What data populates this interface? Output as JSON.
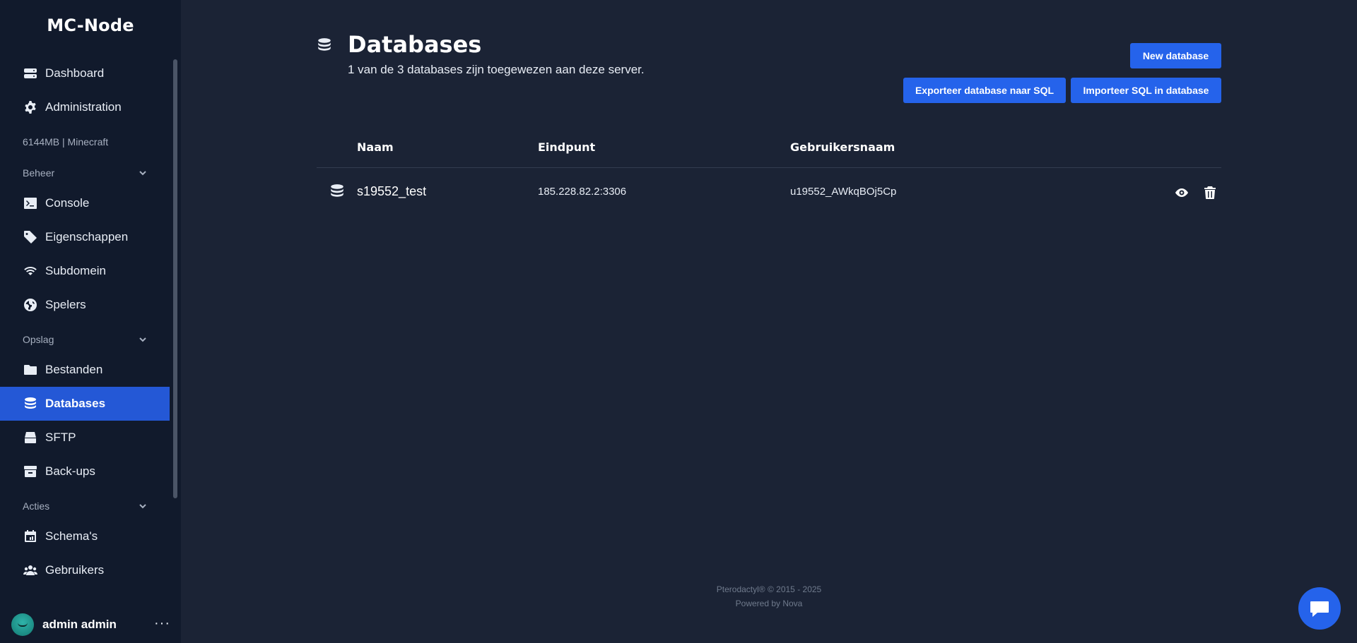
{
  "brand": "MC-Node",
  "sidebar": {
    "top_items": [
      {
        "label": "Dashboard",
        "icon": "server-icon"
      },
      {
        "label": "Administration",
        "icon": "gear-icon"
      }
    ],
    "server_info": "6144MB | Minecraft",
    "sections": [
      {
        "title": "Beheer",
        "items": [
          {
            "label": "Console",
            "icon": "terminal-icon"
          },
          {
            "label": "Eigenschappen",
            "icon": "tag-icon"
          },
          {
            "label": "Subdomein",
            "icon": "wifi-icon"
          },
          {
            "label": "Spelers",
            "icon": "globe-icon"
          }
        ]
      },
      {
        "title": "Opslag",
        "items": [
          {
            "label": "Bestanden",
            "icon": "folder-icon"
          },
          {
            "label": "Databases",
            "icon": "database-icon",
            "active": true
          },
          {
            "label": "SFTP",
            "icon": "hdd-icon"
          },
          {
            "label": "Back-ups",
            "icon": "archive-icon"
          }
        ]
      },
      {
        "title": "Acties",
        "items": [
          {
            "label": "Schema's",
            "icon": "calendar-icon"
          },
          {
            "label": "Gebruikers",
            "icon": "users-icon"
          }
        ]
      }
    ],
    "user": {
      "name": "admin admin",
      "more": "···"
    }
  },
  "page": {
    "title": "Databases",
    "subtitle": "1 van de 3 databases zijn toegewezen aan deze server.",
    "buttons": {
      "new": "New database",
      "export": "Exporteer database naar SQL",
      "import": "Importeer SQL in database"
    }
  },
  "table": {
    "headers": {
      "name": "Naam",
      "endpoint": "Eindpunt",
      "username": "Gebruikersnaam"
    },
    "rows": [
      {
        "name": "s19552_test",
        "endpoint": "185.228.82.2:3306",
        "username": "u19552_AWkqBOj5Cp"
      }
    ]
  },
  "footer": {
    "line1": "Pterodactyl® © 2015 - 2025",
    "line2": "Powered by Nova"
  },
  "colors": {
    "accent": "#2563eb",
    "sidebar_bg": "#111a2c",
    "main_bg": "#1b2335"
  }
}
